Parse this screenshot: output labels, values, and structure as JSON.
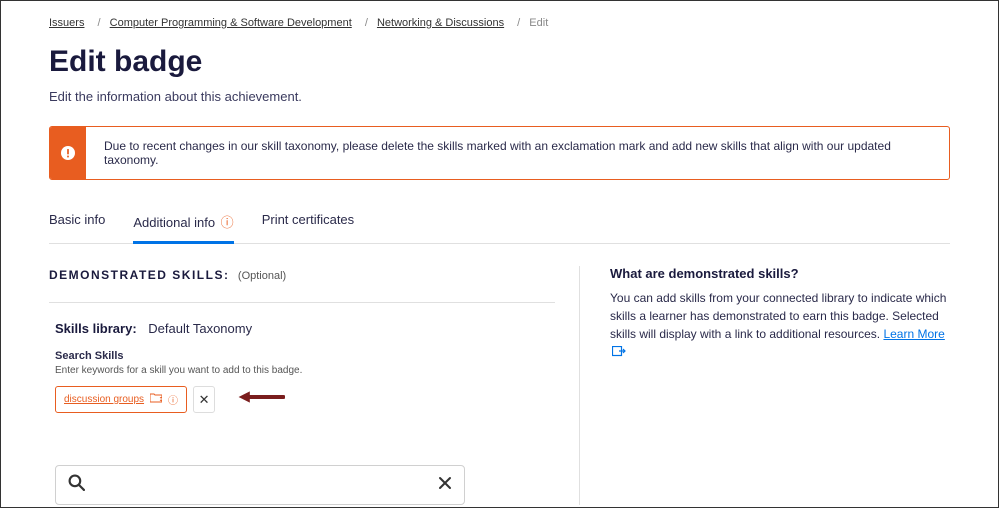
{
  "breadcrumb": {
    "items": [
      {
        "label": "Issuers"
      },
      {
        "label": "Computer Programming & Software Development"
      },
      {
        "label": "Networking & Discussions"
      }
    ],
    "current": "Edit"
  },
  "page": {
    "title": "Edit badge",
    "subtitle": "Edit the information about this achievement."
  },
  "alert": {
    "text": "Due to recent changes in our skill taxonomy, please delete the skills marked with an exclamation mark and add new skills that align with our updated taxonomy."
  },
  "tabs": {
    "items": [
      {
        "label": "Basic info",
        "warn": false
      },
      {
        "label": "Additional info",
        "warn": true
      },
      {
        "label": "Print certificates",
        "warn": false
      }
    ]
  },
  "skills": {
    "section_title": "DEMONSTRATED SKILLS:",
    "optional": "(Optional)",
    "library_label": "Skills library:",
    "library_value": "Default Taxonomy",
    "search_label": "Search Skills",
    "search_hint": "Enter keywords for a skill you want to add to this badge.",
    "chip": {
      "label": "discussion groups"
    },
    "search_placeholder": ""
  },
  "sidebar": {
    "title": "What are demonstrated skills?",
    "text": "You can add skills from your connected library to indicate which skills a learner has demonstrated to earn this badge. Selected skills will display with a link to additional resources. ",
    "learn_more": "Learn More"
  }
}
